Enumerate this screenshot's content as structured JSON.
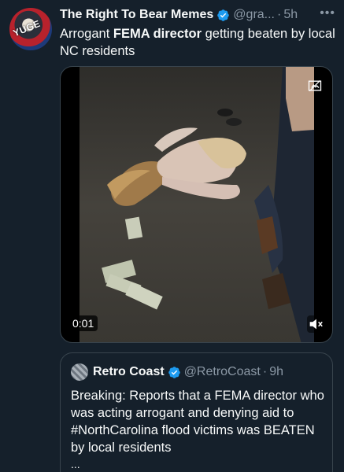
{
  "post": {
    "author_name": "The Right To Bear Memes",
    "handle": "@gra...",
    "separator": "·",
    "time": "5h",
    "more_icon": "more-icon",
    "avatar_text": "YUGE",
    "text_prefix": "Arrogant ",
    "text_bold": "FEMA director",
    "text_suffix": " getting beaten by local NC residents"
  },
  "media": {
    "duration": "0:01",
    "sensitive_icon": "sensitive-content-icon",
    "mute_icon": "volume-muted-icon"
  },
  "quote": {
    "author_name": "Retro Coast",
    "handle": "@RetroCoast",
    "separator": "·",
    "time": "9h",
    "text": "Breaking: Reports that a FEMA director who was acting arrogant and denying aid to #NorthCarolina flood victims was BEATEN by local residents",
    "ellipsis": "..."
  },
  "colors": {
    "background": "#15202b",
    "text": "#f7f9f9",
    "secondary_text": "#8b98a5",
    "verified_blue": "#1d9bf0",
    "border": "#38444d"
  }
}
